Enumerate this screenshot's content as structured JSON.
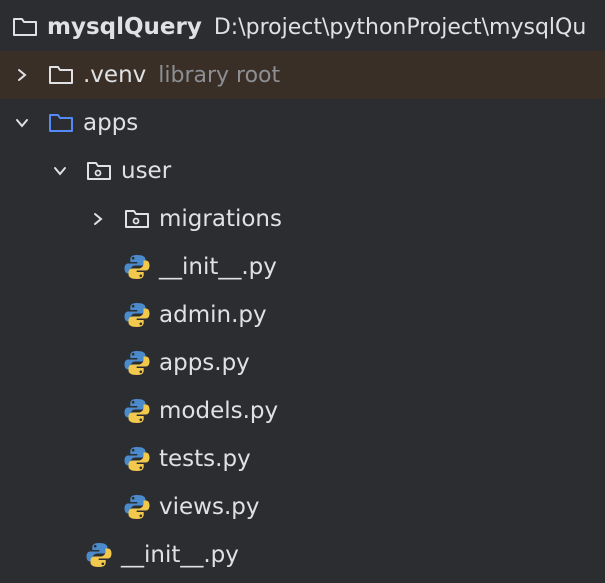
{
  "project": {
    "name": "mysqlQuery",
    "path": "D:\\project\\pythonProject\\mysqlQu"
  },
  "venv": {
    "name": ".venv",
    "hint": "library root"
  },
  "tree": {
    "apps": "apps",
    "user": "user",
    "migrations": "migrations",
    "files": [
      "__init__.py",
      "admin.py",
      "apps.py",
      "models.py",
      "tests.py",
      "views.py"
    ],
    "apps_init": "__init__.py"
  },
  "icons": {
    "folder": "folder-icon",
    "package": "package-folder-icon",
    "python": "python-file-icon",
    "chevron_right": "chevron-right-icon",
    "chevron_down": "chevron-down-icon"
  },
  "colors": {
    "background": "#2b2d30",
    "venv_highlight": "#3a2f26",
    "text": "#dfe1e5",
    "muted": "#8c8f94",
    "folder_blue": "#548af7",
    "python_blue": "#4b8bcc",
    "python_yellow": "#f2c94c"
  }
}
